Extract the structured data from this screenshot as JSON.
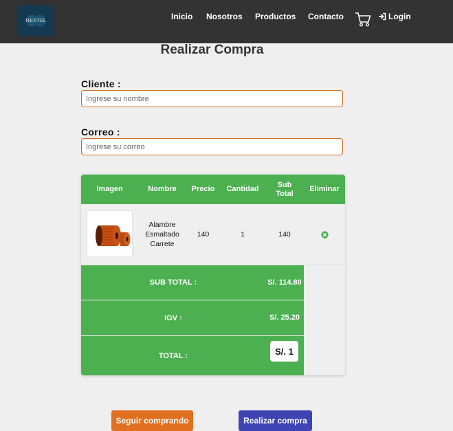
{
  "brand": {
    "logo_text": "MENTEL"
  },
  "nav": {
    "items": [
      {
        "label": "Inicio"
      },
      {
        "label": "Nosotros"
      },
      {
        "label": "Productos"
      },
      {
        "label": "Contacto"
      }
    ],
    "cart_icon": "shopping-cart-icon",
    "login_label": "Login",
    "login_icon": "sign-in-icon"
  },
  "page": {
    "title": "Realizar Compra"
  },
  "form": {
    "client_label": "Cliente :",
    "client_placeholder": "Ingrese su nombre",
    "email_label": "Correo :",
    "email_placeholder": "Ingrese su correo"
  },
  "cart": {
    "headers": {
      "image": "Imagen",
      "name": "Nombre",
      "price": "Precio",
      "quantity": "Cantidad",
      "subtotal": "Sub Total",
      "delete": "Eliminar"
    },
    "items": [
      {
        "image_alt": "copper-wire-spool-image",
        "name": "Alambre Esmaltado Carrete",
        "price": "140",
        "quantity": "1",
        "subtotal": "140",
        "delete_icon": "remove-circle-icon"
      }
    ],
    "summary": {
      "subtotal_label": "SUB TOTAL :",
      "subtotal_value": "S/. 114.80",
      "igv_label": "IGV :",
      "igv_value": "S/. 25.20",
      "total_label": "TOTAL :",
      "total_value": "S/. 1"
    }
  },
  "actions": {
    "continue_label": "Seguir comprando",
    "purchase_label": "Realizar compra"
  },
  "colors": {
    "navbar": "#333333",
    "table_green": "#4caf50",
    "input_border": "#d2691e",
    "continue_button": "#e07020",
    "purchase_button": "#3f44b5"
  }
}
